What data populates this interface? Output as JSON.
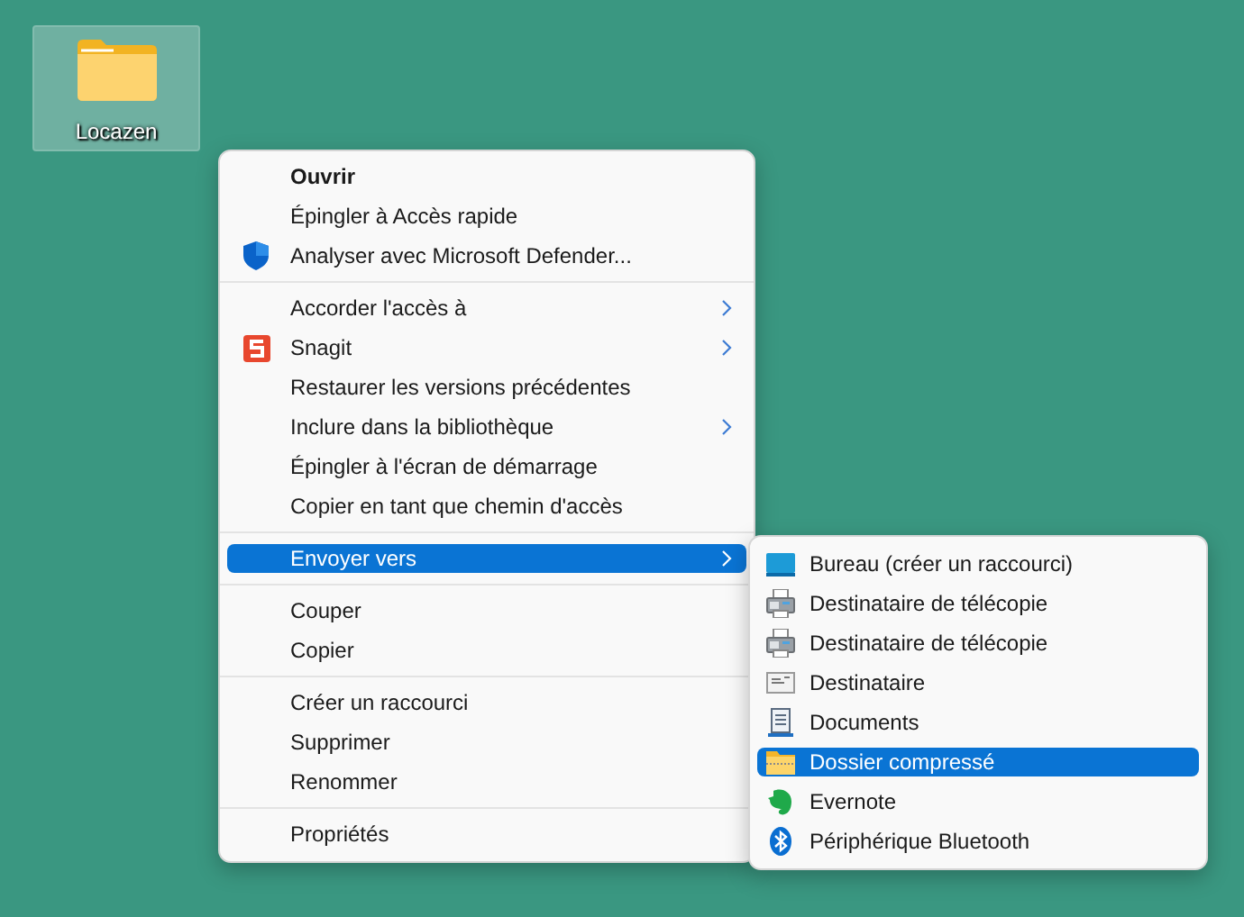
{
  "desktop_icons": [
    {
      "label": "Locazen",
      "selected": true
    }
  ],
  "context_menu": {
    "groups": [
      {
        "items": [
          {
            "label": "Ouvrir",
            "default": true,
            "kind": "none",
            "submenu": false,
            "selected": false
          },
          {
            "label": "Épingler à Accès rapide",
            "default": false,
            "kind": "none",
            "submenu": false,
            "selected": false
          },
          {
            "label": "Analyser avec Microsoft Defender...",
            "default": false,
            "kind": "shield",
            "submenu": false,
            "selected": false
          }
        ]
      },
      {
        "items": [
          {
            "label": "Accorder l'accès à",
            "default": false,
            "kind": "none",
            "submenu": true,
            "selected": false
          },
          {
            "label": "Snagit",
            "default": false,
            "kind": "snagit",
            "submenu": true,
            "selected": false
          },
          {
            "label": "Restaurer les versions précédentes",
            "default": false,
            "kind": "none",
            "submenu": false,
            "selected": false
          },
          {
            "label": "Inclure dans la bibliothèque",
            "default": false,
            "kind": "none",
            "submenu": true,
            "selected": false
          },
          {
            "label": "Épingler à l'écran de démarrage",
            "default": false,
            "kind": "none",
            "submenu": false,
            "selected": false
          },
          {
            "label": "Copier en tant que chemin d'accès",
            "default": false,
            "kind": "none",
            "submenu": false,
            "selected": false
          }
        ]
      },
      {
        "items": [
          {
            "label": "Envoyer vers",
            "default": false,
            "kind": "none",
            "submenu": true,
            "selected": true
          }
        ]
      },
      {
        "items": [
          {
            "label": "Couper",
            "default": false,
            "kind": "none",
            "submenu": false,
            "selected": false
          },
          {
            "label": "Copier",
            "default": false,
            "kind": "none",
            "submenu": false,
            "selected": false
          }
        ]
      },
      {
        "items": [
          {
            "label": "Créer un raccourci",
            "default": false,
            "kind": "none",
            "submenu": false,
            "selected": false
          },
          {
            "label": "Supprimer",
            "default": false,
            "kind": "none",
            "submenu": false,
            "selected": false
          },
          {
            "label": "Renommer",
            "default": false,
            "kind": "none",
            "submenu": false,
            "selected": false
          }
        ]
      },
      {
        "items": [
          {
            "label": "Propriétés",
            "default": false,
            "kind": "none",
            "submenu": false,
            "selected": false
          }
        ]
      }
    ]
  },
  "send_to_menu": {
    "items": [
      {
        "label": "Bureau (créer un raccourci)",
        "kind": "desktop",
        "selected": false
      },
      {
        "label": "Destinataire de télécopie",
        "kind": "fax",
        "selected": false
      },
      {
        "label": "Destinataire de télécopie",
        "kind": "fax",
        "selected": false
      },
      {
        "label": "Destinataire",
        "kind": "mail",
        "selected": false
      },
      {
        "label": "Documents",
        "kind": "document",
        "selected": false
      },
      {
        "label": "Dossier compressé",
        "kind": "zip",
        "selected": true
      },
      {
        "label": "Evernote",
        "kind": "evernote",
        "selected": false
      },
      {
        "label": "Périphérique Bluetooth",
        "kind": "bluetooth",
        "selected": false
      }
    ]
  }
}
